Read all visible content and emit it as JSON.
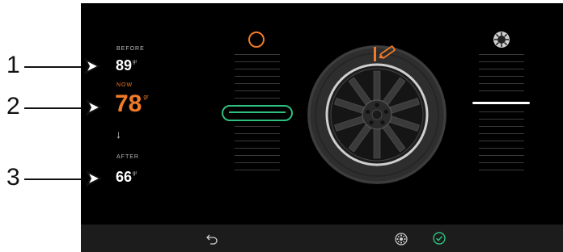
{
  "callouts": [
    "1",
    "2",
    "3"
  ],
  "readings": {
    "before_label": "BEFORE",
    "before_value": "89",
    "before_unit": "gr",
    "now_label": "NOW",
    "now_value": "78",
    "now_unit": "gr",
    "after_label": "AFTER",
    "after_value": "66",
    "after_unit": "gr"
  },
  "icons": {
    "left_column": "ring-icon",
    "right_column": "tire-icon",
    "wheel_marker": "pencil-icon",
    "back": "back-arrow-icon",
    "mode": "wheel-mode-icon",
    "confirm": "check-circle-icon"
  },
  "colors": {
    "accent": "#f07a27",
    "selected": "#2fbf7f",
    "background": "#000000",
    "bar": "#1c1c1c"
  }
}
